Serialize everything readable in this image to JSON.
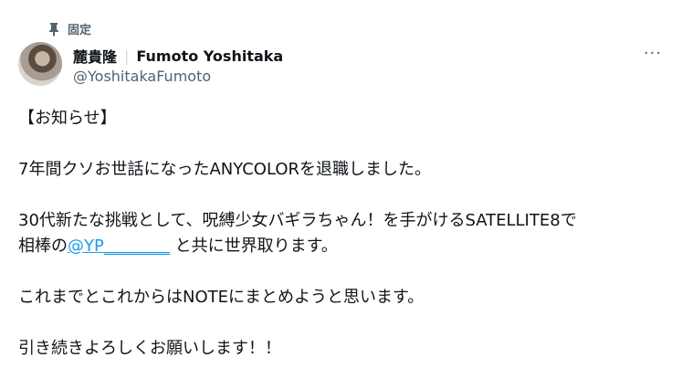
{
  "pinned": {
    "label": "固定",
    "icon": "pin-icon"
  },
  "author": {
    "name_jp": "麓貴隆",
    "separator": "|",
    "name_en": "Fumoto Yoshitaka",
    "handle": "@YoshitakaFumoto"
  },
  "more_button": "···",
  "tweet": {
    "line1": "【お知らせ】",
    "line2": "7年間クソお世話になったANYCOLORを退職しました。",
    "line3": "30代新たな挑戦として、呪縛少女バギラちゃん！を手がけるSATELLITE8で",
    "line4_prefix": "相棒の",
    "mention": "@YP________",
    "line4_suffix": " と共に世界取ります。",
    "line5": "これまでとこれからはNOTEにまとめようと思います。",
    "line6": "引き続きよろしくお願いします！！"
  },
  "colors": {
    "text": "#0f1419",
    "secondary": "#536471",
    "link": "#1d9bf0"
  }
}
